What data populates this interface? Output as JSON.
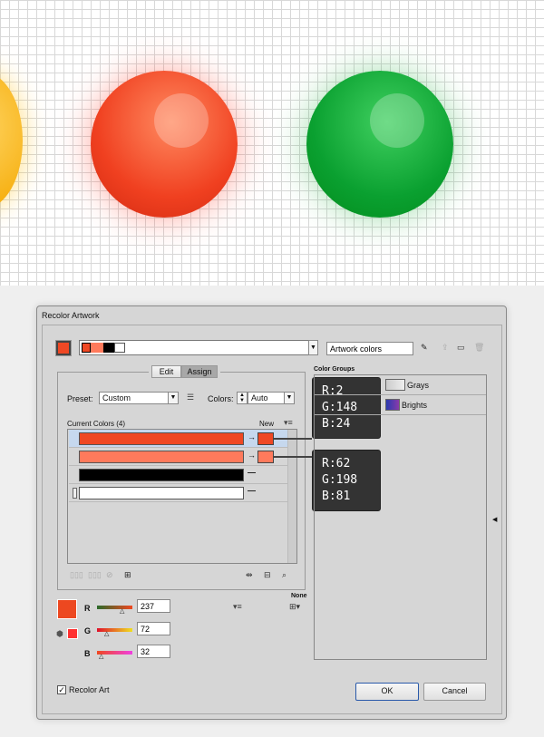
{
  "dialog": {
    "title": "Recolor Artwork"
  },
  "top": {
    "artwork_colors_value": "Artwork colors",
    "swatch_colors": [
      "#ef4824",
      "#ff7a5c",
      "#000000",
      "#ffffff"
    ]
  },
  "tabs": [
    {
      "label": "Edit",
      "active": false
    },
    {
      "label": "Assign",
      "active": true
    }
  ],
  "preset": {
    "label": "Preset:",
    "value": "Custom"
  },
  "colors": {
    "label": "Colors:",
    "value": "Auto"
  },
  "current_colors": {
    "header": "Current Colors (4)",
    "new_header": "New",
    "rows": [
      {
        "color": "#ef4824",
        "new": "#ef4824",
        "selected": true
      },
      {
        "color": "#ff7a5c",
        "new": "#ff7a5c",
        "selected": false
      },
      {
        "color": "#000000",
        "new": null
      },
      {
        "color": "#ffffff",
        "new": null
      }
    ]
  },
  "tooltips": [
    {
      "lines": [
        "R:2",
        "G:148",
        "B:24"
      ]
    },
    {
      "lines": [
        "R:62",
        "G:198",
        "B:81"
      ]
    }
  ],
  "color_groups": {
    "label": "Color Groups",
    "items": [
      {
        "name": "Grays"
      },
      {
        "name": "Brights"
      }
    ]
  },
  "rgb": {
    "r_label": "R",
    "r": "237",
    "g_label": "G",
    "g": "72",
    "b_label": "B",
    "b": "32",
    "color": "#ed4820"
  },
  "none_label": "None",
  "recolor_art": {
    "label": "Recolor Art",
    "checked": true
  },
  "buttons": {
    "ok": "OK",
    "cancel": "Cancel"
  }
}
